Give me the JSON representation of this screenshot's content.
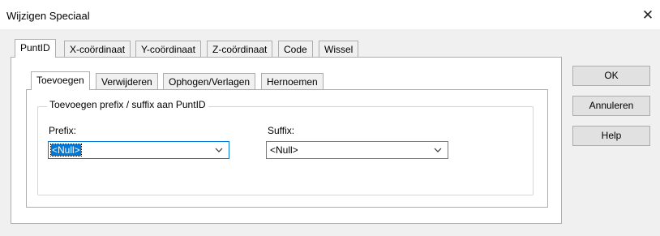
{
  "window": {
    "title": "Wijzigen Speciaal",
    "close_glyph": "✕"
  },
  "main_tabs": [
    {
      "label": "PuntID",
      "active": true
    },
    {
      "label": "X-coördinaat",
      "active": false
    },
    {
      "label": "Y-coördinaat",
      "active": false
    },
    {
      "label": "Z-coördinaat",
      "active": false
    },
    {
      "label": "Code",
      "active": false
    },
    {
      "label": "Wissel",
      "active": false
    }
  ],
  "sub_tabs": [
    {
      "label": "Toevoegen",
      "active": true
    },
    {
      "label": "Verwijderen",
      "active": false
    },
    {
      "label": "Ophogen/Verlagen",
      "active": false
    },
    {
      "label": "Hernoemen",
      "active": false
    }
  ],
  "group": {
    "title": "Toevoegen prefix / suffix aan PuntID",
    "prefix": {
      "label": "Prefix:",
      "value": "<Null>"
    },
    "suffix": {
      "label": "Suffix:",
      "value": "<Null>"
    }
  },
  "buttons": {
    "ok": "OK",
    "cancel": "Annuleren",
    "help": "Help"
  },
  "colors": {
    "focus": "#0078d7",
    "button_face": "#e1e1e1",
    "dialog_bg": "#f0f0f0"
  }
}
